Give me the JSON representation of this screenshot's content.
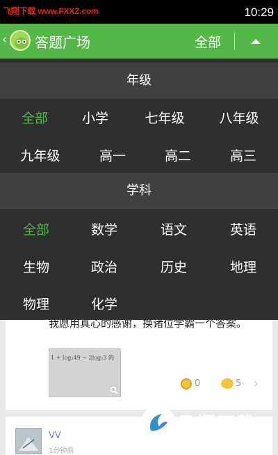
{
  "status_bar": {
    "watermark": "飞翔下载 www.FXXZ.com",
    "time": "10:29"
  },
  "app_bar": {
    "title": "答题广场",
    "filter": "全部"
  },
  "grade_section": {
    "title": "年级",
    "options": [
      "全部",
      "小学",
      "七年级",
      "八年级",
      "九年级",
      "高一",
      "高二",
      "高三"
    ],
    "selected": "全部"
  },
  "subject_section": {
    "title": "学科",
    "options": [
      "全部",
      "数学",
      "语文",
      "英语",
      "生物",
      "政治",
      "历史",
      "地理",
      "物理",
      "化学"
    ],
    "selected": "全部"
  },
  "feed": {
    "card1": {
      "text": "我愿用真心的感谢，换诸位学霸一个答案。",
      "image_text": "1 + log₂49 − 2log₂3 的",
      "coin_count": "0",
      "comment_count": "5"
    },
    "card2": {
      "user": "VV",
      "time": "1分钟前"
    }
  },
  "watermark": {
    "title": "飞翔下载",
    "url": "WWW.FXXZ.COM"
  },
  "colors": {
    "app_bar": "#54b848",
    "selected": "#4fb748",
    "overlay": "#2f2f2f",
    "section_head": "#404040"
  }
}
